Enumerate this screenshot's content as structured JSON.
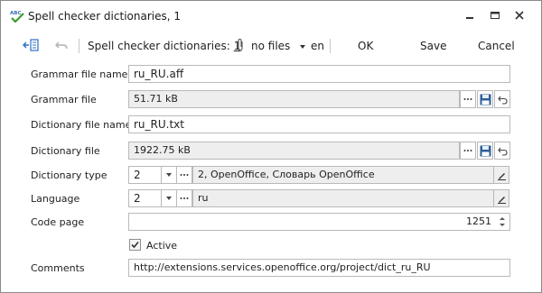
{
  "window": {
    "title": "Spell checker dictionaries, 1",
    "icon": "abc-spellcheck-icon"
  },
  "toolbar": {
    "record_label": "Spell checker dictionaries:",
    "record_count": "1",
    "files_label": "no files",
    "language_label": "en",
    "ok_label": "OK",
    "save_label": "Save",
    "cancel_label": "Cancel"
  },
  "form": {
    "grammar_file_name": {
      "label": "Grammar file name",
      "value": "ru_RU.aff"
    },
    "grammar_file": {
      "label": "Grammar file",
      "value": "51.71 kB"
    },
    "dictionary_file_name": {
      "label": "Dictionary file name",
      "value": "ru_RU.txt"
    },
    "dictionary_file": {
      "label": "Dictionary file",
      "value": "1922.75 kB"
    },
    "dictionary_type": {
      "label": "Dictionary type",
      "code": "2",
      "description": "2, OpenOffice, Словарь OpenOffice"
    },
    "language": {
      "label": "Language",
      "code": "2",
      "description": "ru"
    },
    "code_page": {
      "label": "Code page",
      "value": "1251"
    },
    "active": {
      "label": "Active",
      "checked": true
    },
    "comments": {
      "label": "Comments",
      "value": "http://extensions.services.openoffice.org/project/dict_ru_RU"
    }
  }
}
